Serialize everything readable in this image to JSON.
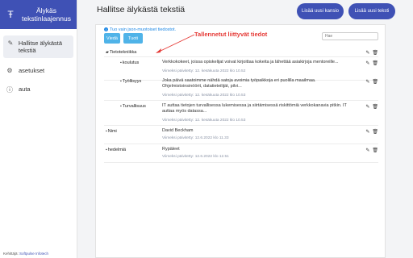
{
  "sidebar": {
    "app_title": "Älykäs tekstinlaajennus",
    "items": [
      {
        "label": "Hallitse älykästä tekstiä",
        "icon": "edit-icon",
        "glyph": "✎"
      },
      {
        "label": "asetukset",
        "icon": "settings-icon",
        "glyph": "⚙"
      },
      {
        "label": "auta",
        "icon": "help-icon",
        "glyph": "ⓘ"
      }
    ],
    "footer_prefix": "Kehittäjä:",
    "footer_link": "Softpulse Infotech"
  },
  "header": {
    "title": "Hallitse älykästä tekstiä",
    "add_folder": "Lisää uusi kansio",
    "add_text": "Lisää uusi teksti"
  },
  "panel": {
    "info": "Tuo vain json-muotoiset tiedostot.",
    "export_label": "Viedä",
    "import_label": "Tuoti",
    "search_placeholder": "Hae",
    "annotation": "Tallennetut liittyvät tiedot",
    "folder": "Tietotekniikka",
    "rows": [
      {
        "name": "koulutus",
        "text": "Verkkokokeet, joissa opiskelijat voivat kirjoittaa kokeita ja lähettää asiakirjoja mentoreille...",
        "date": "Viimeksi päivitetty: 12. kesäkuuta 2022 klo 10.52"
      },
      {
        "name": "Työllisyys",
        "text": "Joka päivä saatoimme nähdä satoja avoimia työpaikkoja eri puolilla maailmaa. Ohjelmistoinsinöörit, datatieteilijät, pilvi...",
        "date": "Viimeksi päivitetty: 12. kesäkuuta 2022 klo 10.53"
      },
      {
        "name": "Turvallisuus",
        "text": "IT auttaa tietojen turvallisessa lukemisessa ja siirtämisessä riskittömiä verkkokanavia pitkin. IT auttaa myös datassa...",
        "date": "Viimeksi päivitetty: 12. kesäkuuta 2022 klo 10.53"
      },
      {
        "name": "Nimi",
        "text": "David Beckham",
        "date": "Viimeksi päivitetty: 12.6.2022 klo 11.33"
      },
      {
        "name": "hedelmiä",
        "text": "Rypäleet",
        "date": "Viimeksi päivitetty: 12.6.2022 klo 12.51"
      }
    ]
  },
  "colors": {
    "accent": "#3f51b5",
    "button_light": "#4fb3e8",
    "annotation": "#e53935"
  }
}
